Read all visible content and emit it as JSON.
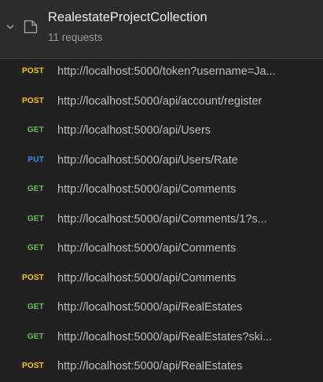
{
  "collection": {
    "name": "RealestateProjectCollection",
    "count_label": "11 requests"
  },
  "colors": {
    "POST": "#f5c518",
    "GET": "#6bbd5b",
    "PUT": "#3b8de8"
  },
  "requests": [
    {
      "method": "POST",
      "url": "http://localhost:5000/token?username=Ja..."
    },
    {
      "method": "POST",
      "url": "http://localhost:5000/api/account/register"
    },
    {
      "method": "GET",
      "url": "http://localhost:5000/api/Users"
    },
    {
      "method": "PUT",
      "url": "http://localhost:5000/api/Users/Rate"
    },
    {
      "method": "GET",
      "url": "http://localhost:5000/api/Comments"
    },
    {
      "method": "GET",
      "url": "http://localhost:5000/api/Comments/1?s..."
    },
    {
      "method": "GET",
      "url": "http://localhost:5000/api/Comments"
    },
    {
      "method": "POST",
      "url": "http://localhost:5000/api/Comments"
    },
    {
      "method": "GET",
      "url": "http://localhost:5000/api/RealEstates"
    },
    {
      "method": "GET",
      "url": "http://localhost:5000/api/RealEstates?ski..."
    },
    {
      "method": "POST",
      "url": "http://localhost:5000/api/RealEstates"
    }
  ]
}
